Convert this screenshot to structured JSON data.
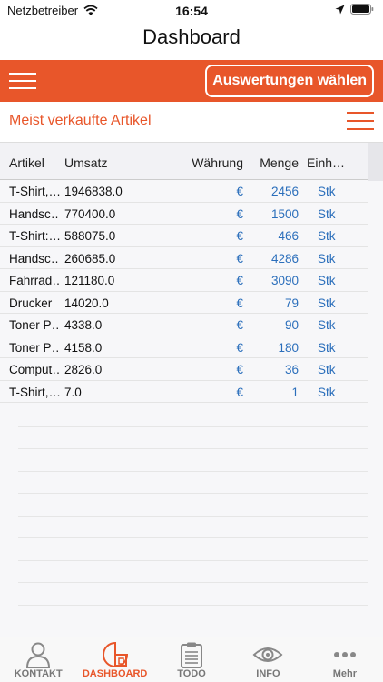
{
  "status_bar": {
    "carrier": "Netzbetreiber",
    "time": "16:54"
  },
  "nav": {
    "title": "Dashboard"
  },
  "toolbar": {
    "button_label": "Auswertungen wählen"
  },
  "section": {
    "title": "Meist verkaufte Artikel"
  },
  "table": {
    "headers": {
      "artikel": "Artikel",
      "umsatz": "Umsatz",
      "waehrung": "Währung",
      "menge": "Menge",
      "einheit": "Einh…"
    },
    "rows": [
      {
        "artikel": "T-Shirt,…",
        "umsatz": "1946838.0",
        "waehrung": "€",
        "menge": "2456",
        "einheit": "Stk"
      },
      {
        "artikel": "Handsc…",
        "umsatz": "770400.0",
        "waehrung": "€",
        "menge": "1500",
        "einheit": "Stk"
      },
      {
        "artikel": "T-Shirt:…",
        "umsatz": "588075.0",
        "waehrung": "€",
        "menge": "466",
        "einheit": "Stk"
      },
      {
        "artikel": "Handsc…",
        "umsatz": "260685.0",
        "waehrung": "€",
        "menge": "4286",
        "einheit": "Stk"
      },
      {
        "artikel": "Fahrrad…",
        "umsatz": "121180.0",
        "waehrung": "€",
        "menge": "3090",
        "einheit": "Stk"
      },
      {
        "artikel": "Drucker",
        "umsatz": "14020.0",
        "waehrung": "€",
        "menge": "79",
        "einheit": "Stk"
      },
      {
        "artikel": "Toner P…",
        "umsatz": "4338.0",
        "waehrung": "€",
        "menge": "90",
        "einheit": "Stk"
      },
      {
        "artikel": "Toner P…",
        "umsatz": "4158.0",
        "waehrung": "€",
        "menge": "180",
        "einheit": "Stk"
      },
      {
        "artikel": "Comput…",
        "umsatz": "2826.0",
        "waehrung": "€",
        "menge": "36",
        "einheit": "Stk"
      },
      {
        "artikel": "T-Shirt,…",
        "umsatz": "7.0",
        "waehrung": "€",
        "menge": "1",
        "einheit": "Stk"
      }
    ]
  },
  "tabbar": {
    "tabs": [
      {
        "label": "KONTAKT",
        "icon": "person-icon",
        "active": false
      },
      {
        "label": "DASHBOARD",
        "icon": "dashboard-icon",
        "active": true
      },
      {
        "label": "TODO",
        "icon": "clipboard-icon",
        "active": false
      },
      {
        "label": "INFO",
        "icon": "eye-icon",
        "active": false
      },
      {
        "label": "Mehr",
        "icon": "more-icon",
        "active": false
      }
    ]
  },
  "colors": {
    "accent": "#e8562a",
    "link": "#2a6ebb"
  }
}
